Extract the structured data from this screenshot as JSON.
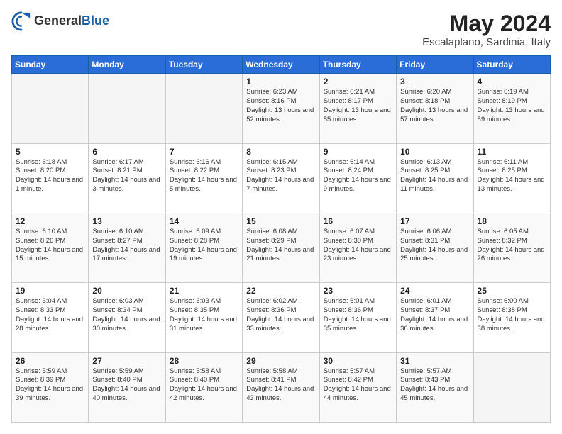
{
  "header": {
    "logo": {
      "text_general": "General",
      "text_blue": "Blue"
    },
    "title": "May 2024",
    "location": "Escalaplano, Sardinia, Italy"
  },
  "calendar": {
    "days_of_week": [
      "Sunday",
      "Monday",
      "Tuesday",
      "Wednesday",
      "Thursday",
      "Friday",
      "Saturday"
    ],
    "weeks": [
      [
        {
          "day": "",
          "sunrise": "",
          "sunset": "",
          "daylight": ""
        },
        {
          "day": "",
          "sunrise": "",
          "sunset": "",
          "daylight": ""
        },
        {
          "day": "",
          "sunrise": "",
          "sunset": "",
          "daylight": ""
        },
        {
          "day": "1",
          "sunrise": "Sunrise: 6:23 AM",
          "sunset": "Sunset: 8:16 PM",
          "daylight": "Daylight: 13 hours and 52 minutes."
        },
        {
          "day": "2",
          "sunrise": "Sunrise: 6:21 AM",
          "sunset": "Sunset: 8:17 PM",
          "daylight": "Daylight: 13 hours and 55 minutes."
        },
        {
          "day": "3",
          "sunrise": "Sunrise: 6:20 AM",
          "sunset": "Sunset: 8:18 PM",
          "daylight": "Daylight: 13 hours and 57 minutes."
        },
        {
          "day": "4",
          "sunrise": "Sunrise: 6:19 AM",
          "sunset": "Sunset: 8:19 PM",
          "daylight": "Daylight: 13 hours and 59 minutes."
        }
      ],
      [
        {
          "day": "5",
          "sunrise": "Sunrise: 6:18 AM",
          "sunset": "Sunset: 8:20 PM",
          "daylight": "Daylight: 14 hours and 1 minute."
        },
        {
          "day": "6",
          "sunrise": "Sunrise: 6:17 AM",
          "sunset": "Sunset: 8:21 PM",
          "daylight": "Daylight: 14 hours and 3 minutes."
        },
        {
          "day": "7",
          "sunrise": "Sunrise: 6:16 AM",
          "sunset": "Sunset: 8:22 PM",
          "daylight": "Daylight: 14 hours and 5 minutes."
        },
        {
          "day": "8",
          "sunrise": "Sunrise: 6:15 AM",
          "sunset": "Sunset: 8:23 PM",
          "daylight": "Daylight: 14 hours and 7 minutes."
        },
        {
          "day": "9",
          "sunrise": "Sunrise: 6:14 AM",
          "sunset": "Sunset: 8:24 PM",
          "daylight": "Daylight: 14 hours and 9 minutes."
        },
        {
          "day": "10",
          "sunrise": "Sunrise: 6:13 AM",
          "sunset": "Sunset: 8:25 PM",
          "daylight": "Daylight: 14 hours and 11 minutes."
        },
        {
          "day": "11",
          "sunrise": "Sunrise: 6:11 AM",
          "sunset": "Sunset: 8:25 PM",
          "daylight": "Daylight: 14 hours and 13 minutes."
        }
      ],
      [
        {
          "day": "12",
          "sunrise": "Sunrise: 6:10 AM",
          "sunset": "Sunset: 8:26 PM",
          "daylight": "Daylight: 14 hours and 15 minutes."
        },
        {
          "day": "13",
          "sunrise": "Sunrise: 6:10 AM",
          "sunset": "Sunset: 8:27 PM",
          "daylight": "Daylight: 14 hours and 17 minutes."
        },
        {
          "day": "14",
          "sunrise": "Sunrise: 6:09 AM",
          "sunset": "Sunset: 8:28 PM",
          "daylight": "Daylight: 14 hours and 19 minutes."
        },
        {
          "day": "15",
          "sunrise": "Sunrise: 6:08 AM",
          "sunset": "Sunset: 8:29 PM",
          "daylight": "Daylight: 14 hours and 21 minutes."
        },
        {
          "day": "16",
          "sunrise": "Sunrise: 6:07 AM",
          "sunset": "Sunset: 8:30 PM",
          "daylight": "Daylight: 14 hours and 23 minutes."
        },
        {
          "day": "17",
          "sunrise": "Sunrise: 6:06 AM",
          "sunset": "Sunset: 8:31 PM",
          "daylight": "Daylight: 14 hours and 25 minutes."
        },
        {
          "day": "18",
          "sunrise": "Sunrise: 6:05 AM",
          "sunset": "Sunset: 8:32 PM",
          "daylight": "Daylight: 14 hours and 26 minutes."
        }
      ],
      [
        {
          "day": "19",
          "sunrise": "Sunrise: 6:04 AM",
          "sunset": "Sunset: 8:33 PM",
          "daylight": "Daylight: 14 hours and 28 minutes."
        },
        {
          "day": "20",
          "sunrise": "Sunrise: 6:03 AM",
          "sunset": "Sunset: 8:34 PM",
          "daylight": "Daylight: 14 hours and 30 minutes."
        },
        {
          "day": "21",
          "sunrise": "Sunrise: 6:03 AM",
          "sunset": "Sunset: 8:35 PM",
          "daylight": "Daylight: 14 hours and 31 minutes."
        },
        {
          "day": "22",
          "sunrise": "Sunrise: 6:02 AM",
          "sunset": "Sunset: 8:36 PM",
          "daylight": "Daylight: 14 hours and 33 minutes."
        },
        {
          "day": "23",
          "sunrise": "Sunrise: 6:01 AM",
          "sunset": "Sunset: 8:36 PM",
          "daylight": "Daylight: 14 hours and 35 minutes."
        },
        {
          "day": "24",
          "sunrise": "Sunrise: 6:01 AM",
          "sunset": "Sunset: 8:37 PM",
          "daylight": "Daylight: 14 hours and 36 minutes."
        },
        {
          "day": "25",
          "sunrise": "Sunrise: 6:00 AM",
          "sunset": "Sunset: 8:38 PM",
          "daylight": "Daylight: 14 hours and 38 minutes."
        }
      ],
      [
        {
          "day": "26",
          "sunrise": "Sunrise: 5:59 AM",
          "sunset": "Sunset: 8:39 PM",
          "daylight": "Daylight: 14 hours and 39 minutes."
        },
        {
          "day": "27",
          "sunrise": "Sunrise: 5:59 AM",
          "sunset": "Sunset: 8:40 PM",
          "daylight": "Daylight: 14 hours and 40 minutes."
        },
        {
          "day": "28",
          "sunrise": "Sunrise: 5:58 AM",
          "sunset": "Sunset: 8:40 PM",
          "daylight": "Daylight: 14 hours and 42 minutes."
        },
        {
          "day": "29",
          "sunrise": "Sunrise: 5:58 AM",
          "sunset": "Sunset: 8:41 PM",
          "daylight": "Daylight: 14 hours and 43 minutes."
        },
        {
          "day": "30",
          "sunrise": "Sunrise: 5:57 AM",
          "sunset": "Sunset: 8:42 PM",
          "daylight": "Daylight: 14 hours and 44 minutes."
        },
        {
          "day": "31",
          "sunrise": "Sunrise: 5:57 AM",
          "sunset": "Sunset: 8:43 PM",
          "daylight": "Daylight: 14 hours and 45 minutes."
        },
        {
          "day": "",
          "sunrise": "",
          "sunset": "",
          "daylight": ""
        }
      ]
    ]
  }
}
